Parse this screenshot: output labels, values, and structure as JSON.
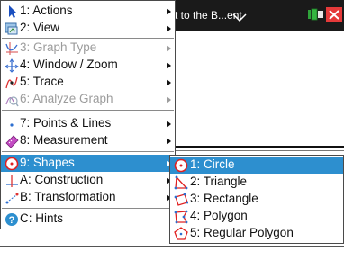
{
  "document": {
    "tab_title": "t to the B...ent"
  },
  "main_menu": {
    "items": [
      {
        "label": "1: Actions",
        "icon": "cursor-icon",
        "enabled": true,
        "submenu": true
      },
      {
        "label": "2: View",
        "icon": "view-icon",
        "enabled": true,
        "submenu": true
      },
      {
        "label": "3: Graph Type",
        "icon": "graph-type-icon",
        "enabled": false,
        "submenu": true
      },
      {
        "label": "4: Window / Zoom",
        "icon": "window-zoom-icon",
        "enabled": true,
        "submenu": true
      },
      {
        "label": "5: Trace",
        "icon": "trace-icon",
        "enabled": true,
        "submenu": true
      },
      {
        "label": "6: Analyze Graph",
        "icon": "analyze-graph-icon",
        "enabled": false,
        "submenu": true
      },
      {
        "label": "7: Points & Lines",
        "icon": "points-lines-icon",
        "enabled": true,
        "submenu": true
      },
      {
        "label": "8: Measurement",
        "icon": "measurement-icon",
        "enabled": true,
        "submenu": true
      },
      {
        "label": "9: Shapes",
        "icon": "shapes-icon",
        "enabled": true,
        "submenu": true,
        "selected": true
      },
      {
        "label": "A: Construction",
        "icon": "construction-icon",
        "enabled": true,
        "submenu": true
      },
      {
        "label": "B: Transformation",
        "icon": "transformation-icon",
        "enabled": true,
        "submenu": true
      },
      {
        "label": "C: Hints",
        "icon": "hints-icon",
        "enabled": true,
        "submenu": false
      }
    ]
  },
  "shapes_submenu": {
    "items": [
      {
        "label": "1: Circle",
        "icon": "circle-icon",
        "selected": true
      },
      {
        "label": "2: Triangle",
        "icon": "triangle-icon"
      },
      {
        "label": "3: Rectangle",
        "icon": "rectangle-icon"
      },
      {
        "label": "4: Polygon",
        "icon": "polygon-icon"
      },
      {
        "label": "5: Regular Polygon",
        "icon": "regular-polygon-icon"
      }
    ]
  },
  "colors": {
    "selection": "#2d8fcf",
    "disabled_text": "#9c9c9c",
    "title_bar": "#1a1a1a"
  }
}
